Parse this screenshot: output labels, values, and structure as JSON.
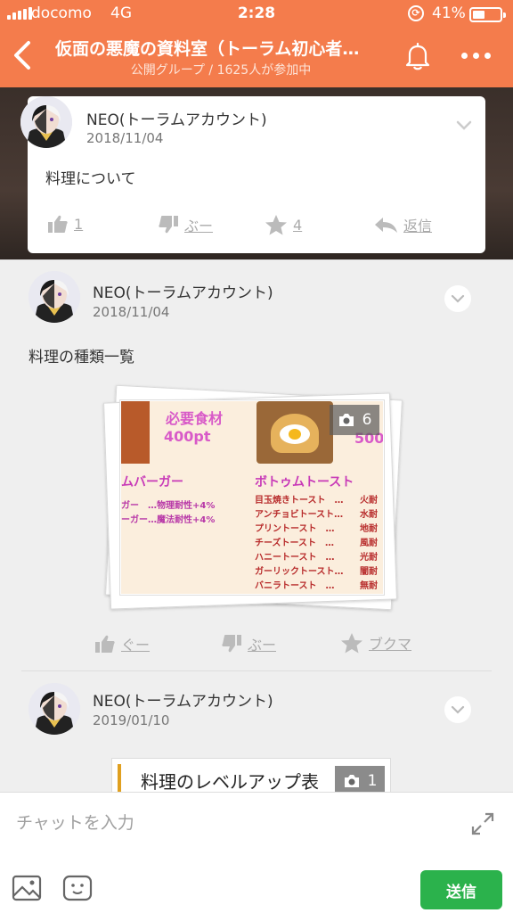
{
  "status_bar": {
    "carrier": "docomo",
    "network": "4G",
    "time": "2:28",
    "battery_pct": "41%"
  },
  "header": {
    "title": "仮面の悪魔の資料室（トーラム初心者…",
    "subtitle": "公開グループ / 1625人が参加中"
  },
  "pinned_post": {
    "author": "NEO(トーラムアカウント)",
    "date": "2018/11/04",
    "text": "料理について",
    "like_count": "1",
    "boo_label": "ぶー",
    "star_count": "4",
    "reply_label": "返信"
  },
  "posts": [
    {
      "author": "NEO(トーラムアカウント)",
      "date": "2018/11/04",
      "text": "料理の種類一覧",
      "photo_count": "6",
      "photo_texts": {
        "required": "必要食材",
        "points": "400pt",
        "points_right": "500",
        "burger": "ムバーガー",
        "toast": "ボトゥムトースト",
        "burger_lines": [
          "ガー　…物理耐性+4%",
          "ーガー…魔法耐性+4%"
        ],
        "toast_lines": [
          "目玉焼きトースト　…",
          "アンチョビトースト…",
          "プリントースト　…",
          "チーズトースト　…",
          "ハニートースト　…",
          "ガーリックトースト…",
          "バニラトースト　…"
        ],
        "toast_right": [
          "火耐",
          "水耐",
          "地耐",
          "風耐",
          "光耐",
          "闇耐",
          "無耐"
        ]
      },
      "actions": {
        "like": "ぐー",
        "boo": "ぶー",
        "bookmark": "ブクマ"
      }
    },
    {
      "author": "NEO(トーラムアカウント)",
      "date": "2019/01/10",
      "photo_title": "料理のレベルアップ表",
      "photo_count": "1"
    }
  ],
  "composer": {
    "placeholder": "チャットを入力",
    "send_label": "送信"
  },
  "colors": {
    "header": "#f47c4c",
    "send": "#2bb24c"
  }
}
